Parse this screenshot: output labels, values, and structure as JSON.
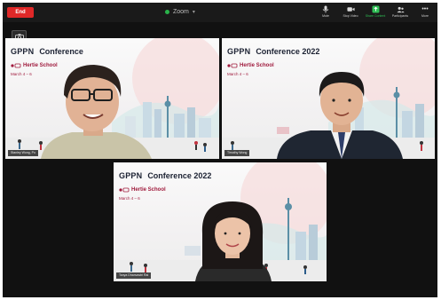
{
  "topbar": {
    "end_label": "End",
    "app_name": "Zoom",
    "tools": [
      {
        "label": "Mute",
        "icon": "microphone-icon"
      },
      {
        "label": "Stop Video",
        "icon": "video-camera-icon"
      },
      {
        "label": "Share Content",
        "icon": "share-screen-icon"
      },
      {
        "label": "Participants",
        "icon": "participants-icon"
      },
      {
        "label": "More",
        "icon": "more-icon"
      }
    ]
  },
  "colors": {
    "end_red": "#e02828",
    "share_green": "#2fbf55",
    "hertie_red": "#a01b3d",
    "app_bg": "#111111"
  },
  "tiles": [
    {
      "logo": "GPPN",
      "conference": "Conference",
      "logo_sub": "",
      "school": "Hertie School",
      "dates": "March 4 – 6",
      "name": "Stanley Wong, Po"
    },
    {
      "logo": "GPPN",
      "conference": "Conference 2022",
      "logo_sub": "",
      "school": "Hertie School",
      "dates": "March 4 – 6",
      "name": "Timothy Wong"
    },
    {
      "logo": "GPPN",
      "conference": "Conference 2022",
      "logo_sub": "",
      "school": "Hertie School",
      "dates": "March 4 – 6",
      "name": "Tanya Dhanvastri Rai"
    }
  ]
}
